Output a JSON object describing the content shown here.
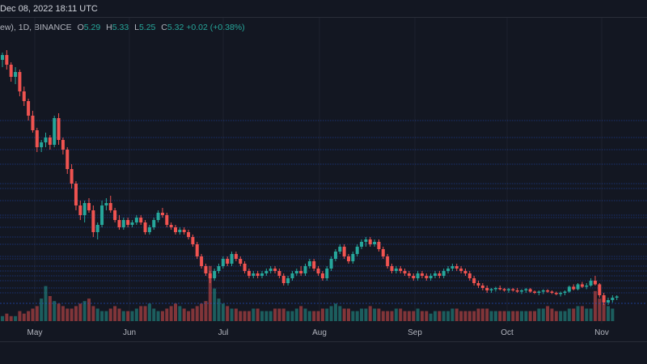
{
  "header": {
    "timestamp": "Dec 08, 2022 18:11 UTC"
  },
  "legend": {
    "symbol": "ew), 1D, BINANCE",
    "o_label": "O",
    "o_value": "5.29",
    "h_label": "H",
    "h_value": "5.33",
    "l_label": "L",
    "l_value": "5.25",
    "c_label": "C",
    "c_value": "5.32",
    "change": "+0.02 (+0.38%)"
  },
  "colors": {
    "up": "#26a69a",
    "down": "#ef5350",
    "background": "#131722",
    "grid": "#1e222d",
    "hline": "#2962ff",
    "axis_text": "#b2b5be"
  },
  "chart_data": {
    "type": "candlestick",
    "x_axis": {
      "ticks": [
        "May",
        "Jun",
        "Jul",
        "Aug",
        "Sep",
        "Oct",
        "Nov"
      ]
    },
    "candles": [
      [
        12.1,
        12.4,
        11.8,
        12.3
      ],
      [
        12.3,
        12.5,
        11.7,
        11.9
      ],
      [
        11.9,
        12.0,
        11.2,
        11.4
      ],
      [
        11.4,
        11.8,
        11.1,
        11.6
      ],
      [
        11.6,
        11.7,
        10.6,
        10.8
      ],
      [
        10.8,
        11.0,
        10.2,
        10.4
      ],
      [
        10.4,
        10.5,
        9.6,
        9.8
      ],
      [
        9.8,
        10.0,
        9.1,
        9.2
      ],
      [
        9.2,
        9.3,
        8.3,
        8.5
      ],
      [
        8.5,
        8.8,
        8.3,
        8.7
      ],
      [
        8.7,
        9.1,
        8.5,
        8.9
      ],
      [
        8.9,
        9.0,
        8.4,
        8.6
      ],
      [
        8.6,
        9.8,
        8.5,
        9.7
      ],
      [
        9.7,
        9.9,
        8.6,
        8.8
      ],
      [
        8.8,
        8.9,
        8.2,
        8.4
      ],
      [
        8.4,
        8.5,
        7.4,
        7.6
      ],
      [
        7.6,
        7.8,
        6.8,
        7.0
      ],
      [
        7.0,
        7.1,
        5.9,
        6.1
      ],
      [
        6.1,
        6.3,
        5.5,
        5.7
      ],
      [
        5.7,
        6.3,
        5.4,
        6.2
      ],
      [
        6.2,
        6.4,
        5.8,
        5.9
      ],
      [
        5.9,
        6.1,
        4.8,
        5.0
      ],
      [
        5.0,
        5.4,
        4.7,
        5.3
      ],
      [
        5.3,
        6.3,
        5.2,
        6.1
      ],
      [
        6.1,
        6.4,
        5.9,
        6.2
      ],
      [
        6.2,
        6.5,
        5.8,
        5.9
      ],
      [
        5.9,
        6.0,
        5.4,
        5.5
      ],
      [
        5.5,
        5.7,
        5.1,
        5.2
      ],
      [
        5.2,
        5.6,
        5.1,
        5.5
      ],
      [
        5.5,
        5.6,
        5.2,
        5.3
      ],
      [
        5.3,
        5.5,
        5.2,
        5.4
      ],
      [
        5.4,
        5.7,
        5.3,
        5.6
      ],
      [
        5.6,
        5.7,
        5.3,
        5.4
      ],
      [
        5.4,
        5.5,
        4.9,
        5.0
      ],
      [
        5.0,
        5.3,
        4.9,
        5.2
      ],
      [
        5.2,
        5.6,
        5.1,
        5.5
      ],
      [
        5.5,
        5.9,
        5.4,
        5.8
      ],
      [
        5.8,
        6.0,
        5.6,
        5.7
      ],
      [
        5.7,
        5.8,
        5.2,
        5.3
      ],
      [
        5.3,
        5.4,
        5.1,
        5.2
      ],
      [
        5.2,
        5.3,
        4.9,
        5.0
      ],
      [
        5.0,
        5.2,
        4.9,
        5.1
      ],
      [
        5.1,
        5.2,
        4.9,
        5.0
      ],
      [
        5.0,
        5.1,
        4.7,
        4.8
      ],
      [
        4.8,
        4.9,
        4.4,
        4.5
      ],
      [
        4.5,
        4.6,
        3.9,
        4.0
      ],
      [
        4.0,
        4.1,
        3.5,
        3.6
      ],
      [
        3.6,
        3.7,
        3.2,
        3.3
      ],
      [
        3.3,
        3.4,
        2.9,
        3.1
      ],
      [
        3.1,
        3.5,
        3.0,
        3.4
      ],
      [
        3.4,
        3.7,
        3.3,
        3.6
      ],
      [
        3.6,
        4.0,
        3.5,
        3.9
      ],
      [
        3.9,
        4.0,
        3.6,
        3.7
      ],
      [
        3.7,
        4.2,
        3.6,
        4.1
      ],
      [
        4.1,
        4.2,
        3.8,
        3.9
      ],
      [
        3.9,
        4.0,
        3.6,
        3.7
      ],
      [
        3.7,
        3.8,
        3.3,
        3.4
      ],
      [
        3.4,
        3.5,
        3.1,
        3.2
      ],
      [
        3.2,
        3.4,
        3.1,
        3.3
      ],
      [
        3.3,
        3.4,
        3.1,
        3.2
      ],
      [
        3.2,
        3.4,
        3.1,
        3.3
      ],
      [
        3.3,
        3.5,
        3.2,
        3.4
      ],
      [
        3.4,
        3.6,
        3.3,
        3.5
      ],
      [
        3.5,
        3.6,
        3.3,
        3.4
      ],
      [
        3.4,
        3.5,
        3.1,
        3.2
      ],
      [
        3.2,
        3.3,
        2.8,
        2.9
      ],
      [
        2.9,
        3.2,
        2.8,
        3.1
      ],
      [
        3.1,
        3.4,
        3.0,
        3.3
      ],
      [
        3.3,
        3.5,
        3.2,
        3.4
      ],
      [
        3.4,
        3.6,
        3.2,
        3.3
      ],
      [
        3.3,
        3.7,
        3.2,
        3.6
      ],
      [
        3.6,
        3.9,
        3.5,
        3.8
      ],
      [
        3.8,
        3.9,
        3.4,
        3.5
      ],
      [
        3.5,
        3.6,
        3.2,
        3.3
      ],
      [
        3.3,
        3.4,
        3.0,
        3.1
      ],
      [
        3.1,
        3.6,
        3.0,
        3.5
      ],
      [
        3.5,
        4.0,
        3.4,
        3.9
      ],
      [
        3.9,
        4.3,
        3.8,
        4.2
      ],
      [
        4.2,
        4.5,
        4.1,
        4.4
      ],
      [
        4.4,
        4.5,
        3.9,
        4.0
      ],
      [
        4.0,
        4.1,
        3.7,
        3.8
      ],
      [
        3.8,
        4.2,
        3.7,
        4.1
      ],
      [
        4.1,
        4.5,
        4.0,
        4.4
      ],
      [
        4.4,
        4.7,
        4.3,
        4.6
      ],
      [
        4.6,
        4.8,
        4.4,
        4.7
      ],
      [
        4.7,
        4.8,
        4.4,
        4.5
      ],
      [
        4.5,
        4.7,
        4.4,
        4.6
      ],
      [
        4.6,
        4.7,
        4.2,
        4.3
      ],
      [
        4.3,
        4.4,
        3.9,
        4.0
      ],
      [
        4.0,
        4.1,
        3.5,
        3.6
      ],
      [
        3.6,
        3.7,
        3.3,
        3.4
      ],
      [
        3.4,
        3.6,
        3.3,
        3.5
      ],
      [
        3.5,
        3.6,
        3.3,
        3.4
      ],
      [
        3.4,
        3.5,
        3.2,
        3.3
      ],
      [
        3.3,
        3.4,
        3.1,
        3.2
      ],
      [
        3.2,
        3.3,
        3.0,
        3.1
      ],
      [
        3.1,
        3.4,
        3.0,
        3.3
      ],
      [
        3.3,
        3.4,
        3.1,
        3.2
      ],
      [
        3.2,
        3.3,
        3.0,
        3.1
      ],
      [
        3.1,
        3.3,
        3.0,
        3.2
      ],
      [
        3.2,
        3.4,
        3.1,
        3.3
      ],
      [
        3.3,
        3.4,
        3.1,
        3.2
      ],
      [
        3.2,
        3.5,
        3.1,
        3.4
      ],
      [
        3.4,
        3.6,
        3.3,
        3.5
      ],
      [
        3.5,
        3.7,
        3.4,
        3.6
      ],
      [
        3.6,
        3.7,
        3.4,
        3.5
      ],
      [
        3.5,
        3.6,
        3.3,
        3.4
      ],
      [
        3.4,
        3.5,
        3.2,
        3.3
      ],
      [
        3.3,
        3.4,
        3.0,
        3.1
      ],
      [
        3.1,
        3.2,
        2.8,
        2.9
      ],
      [
        2.9,
        3.0,
        2.7,
        2.8
      ],
      [
        2.8,
        2.9,
        2.6,
        2.7
      ],
      [
        2.7,
        2.8,
        2.5,
        2.6
      ],
      [
        2.6,
        2.7,
        2.5,
        2.65
      ],
      [
        2.65,
        2.75,
        2.55,
        2.7
      ],
      [
        2.7,
        2.8,
        2.6,
        2.65
      ],
      [
        2.65,
        2.7,
        2.55,
        2.6
      ],
      [
        2.6,
        2.7,
        2.5,
        2.65
      ],
      [
        2.65,
        2.7,
        2.55,
        2.6
      ],
      [
        2.6,
        2.7,
        2.5,
        2.55
      ],
      [
        2.55,
        2.65,
        2.45,
        2.6
      ],
      [
        2.6,
        2.7,
        2.5,
        2.65
      ],
      [
        2.65,
        2.7,
        2.5,
        2.55
      ],
      [
        2.55,
        2.6,
        2.45,
        2.5
      ],
      [
        2.5,
        2.6,
        2.4,
        2.55
      ],
      [
        2.55,
        2.65,
        2.45,
        2.6
      ],
      [
        2.6,
        2.65,
        2.5,
        2.55
      ],
      [
        2.55,
        2.6,
        2.45,
        2.5
      ],
      [
        2.5,
        2.55,
        2.4,
        2.45
      ],
      [
        2.45,
        2.55,
        2.35,
        2.5
      ],
      [
        2.5,
        2.6,
        2.4,
        2.55
      ],
      [
        2.55,
        2.8,
        2.5,
        2.75
      ],
      [
        2.75,
        2.85,
        2.6,
        2.65
      ],
      [
        2.65,
        2.9,
        2.6,
        2.85
      ],
      [
        2.85,
        2.95,
        2.7,
        2.75
      ],
      [
        2.75,
        2.9,
        2.65,
        2.8
      ],
      [
        2.8,
        3.1,
        2.75,
        3.0
      ],
      [
        3.0,
        3.2,
        2.8,
        2.85
      ],
      [
        2.85,
        2.9,
        2.3,
        2.4
      ],
      [
        2.4,
        2.5,
        2.0,
        2.1
      ],
      [
        2.1,
        2.3,
        2.0,
        2.2
      ],
      [
        2.2,
        2.4,
        2.1,
        2.3
      ],
      [
        2.3,
        2.4,
        2.2,
        2.35
      ]
    ],
    "volume": [
      2,
      3,
      2,
      2,
      4,
      3,
      4,
      5,
      6,
      9,
      14,
      10,
      8,
      7,
      6,
      5,
      5,
      6,
      7,
      8,
      9,
      6,
      5,
      4,
      4,
      5,
      6,
      5,
      4,
      4,
      4,
      5,
      6,
      6,
      7,
      5,
      4,
      4,
      5,
      6,
      7,
      6,
      5,
      4,
      5,
      6,
      7,
      8,
      22,
      13,
      9,
      7,
      6,
      5,
      5,
      4,
      4,
      4,
      5,
      5,
      4,
      4,
      4,
      5,
      5,
      5,
      4,
      4,
      5,
      6,
      5,
      4,
      4,
      4,
      5,
      5,
      6,
      7,
      6,
      5,
      5,
      4,
      4,
      5,
      5,
      6,
      5,
      5,
      4,
      4,
      4,
      5,
      5,
      4,
      4,
      4,
      5,
      4,
      4,
      3,
      4,
      4,
      4,
      4,
      5,
      5,
      4,
      4,
      4,
      4,
      5,
      5,
      5,
      4,
      4,
      4,
      4,
      4,
      4,
      4,
      4,
      4,
      4,
      4,
      5,
      5,
      6,
      5,
      4,
      4,
      4,
      5,
      5,
      6,
      6,
      5,
      5,
      12,
      9,
      7,
      6,
      5
    ],
    "price_levels": [
      9.6,
      8.9,
      8.4,
      7.8,
      7.0,
      6.8,
      6.3,
      5.7,
      5.6,
      5.2,
      4.8,
      4.5,
      4.0,
      3.9,
      3.6,
      3.4,
      3.2,
      3.0,
      2.7,
      2.5
    ]
  }
}
